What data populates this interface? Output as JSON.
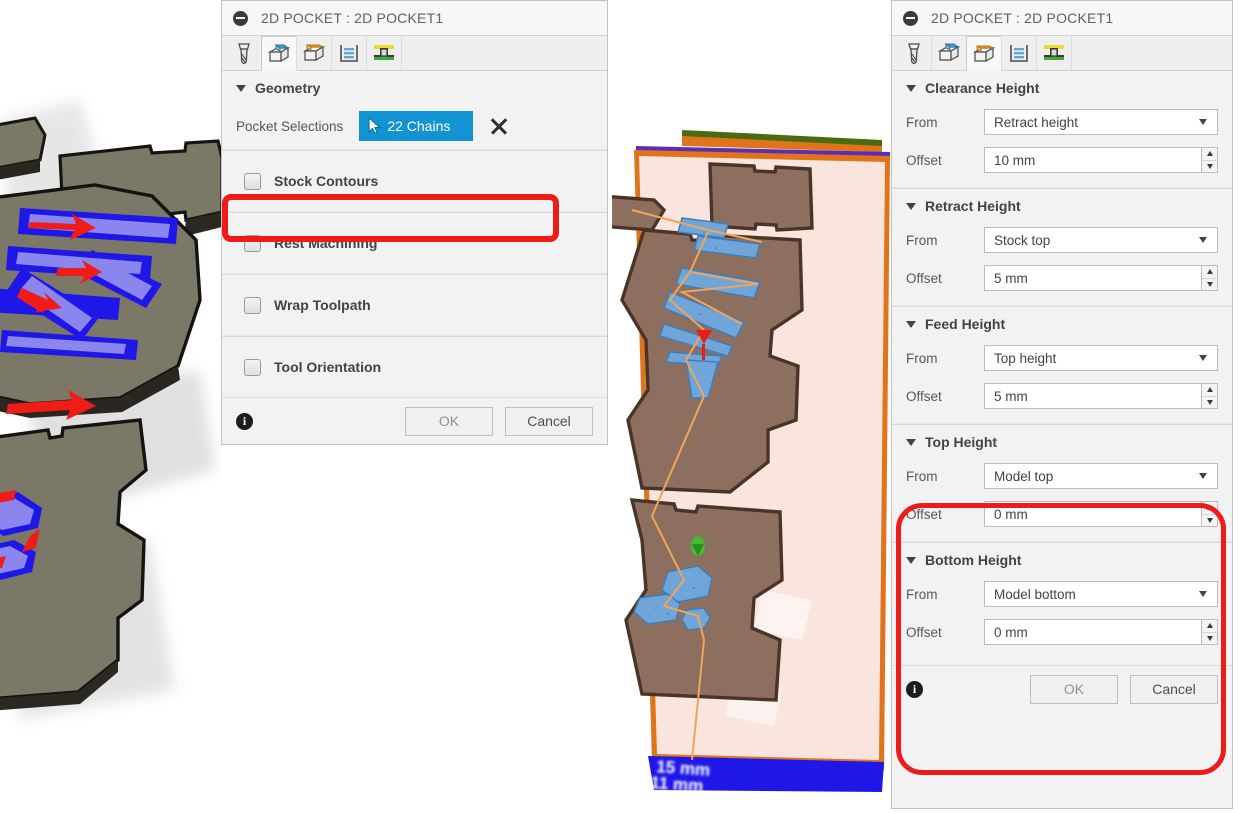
{
  "left_dialog": {
    "title": "2D POCKET : 2D POCKET1",
    "collapse_icon": "collapse-minus-icon",
    "tabs": [
      {
        "name": "tool-tab",
        "icon": "endmill-tool-icon",
        "active": false
      },
      {
        "name": "geometry-tab",
        "icon": "geometry-cube-icon",
        "active": true
      },
      {
        "name": "heights-tab",
        "icon": "heights-cube-icon",
        "active": false
      },
      {
        "name": "passes-tab",
        "icon": "passes-layers-icon",
        "active": false
      },
      {
        "name": "linking-tab",
        "icon": "linking-ramp-icon",
        "active": false
      }
    ],
    "geometry": {
      "section_title": "Geometry",
      "selection_label": "Pocket Selections",
      "chains_button_label": "22 Chains",
      "chains_button_color": "#1294d4",
      "chains_cursor_icon": "cursor-arrow-icon",
      "clear_icon": "close-x-icon"
    },
    "options": [
      {
        "label": "Stock Contours",
        "checked": false,
        "highlighted": true
      },
      {
        "label": "Rest Machining",
        "checked": false,
        "highlighted": false
      },
      {
        "label": "Wrap Toolpath",
        "checked": false,
        "highlighted": false
      },
      {
        "label": "Tool Orientation",
        "checked": false,
        "highlighted": false
      }
    ],
    "footer": {
      "info_icon": "info-icon",
      "info_glyph": "i",
      "ok_label": "OK",
      "cancel_label": "Cancel",
      "ok_disabled": true
    }
  },
  "right_dialog": {
    "title": "2D POCKET : 2D POCKET1",
    "collapse_icon": "collapse-minus-icon",
    "tabs": [
      {
        "name": "tool-tab",
        "icon": "endmill-tool-icon",
        "active": false
      },
      {
        "name": "geometry-tab",
        "icon": "geometry-cube-icon",
        "active": false
      },
      {
        "name": "heights-tab",
        "icon": "heights-cube-icon",
        "active": true
      },
      {
        "name": "passes-tab",
        "icon": "passes-layers-icon",
        "active": false
      },
      {
        "name": "linking-tab",
        "icon": "linking-ramp-icon",
        "active": false
      }
    ],
    "from_label": "From",
    "offset_label": "Offset",
    "sections": [
      {
        "title": "Clearance Height",
        "from_value": "Retract height",
        "offset_value": "10 mm",
        "highlighted": false
      },
      {
        "title": "Retract Height",
        "from_value": "Stock top",
        "offset_value": "5 mm",
        "highlighted": false
      },
      {
        "title": "Feed Height",
        "from_value": "Top height",
        "offset_value": "5 mm",
        "highlighted": false
      },
      {
        "title": "Top Height",
        "from_value": "Model top",
        "offset_value": "0 mm",
        "highlighted": true
      },
      {
        "title": "Bottom Height",
        "from_value": "Model bottom",
        "offset_value": "0 mm",
        "highlighted": true
      }
    ],
    "footer": {
      "info_icon": "info-icon",
      "info_glyph": "i",
      "ok_label": "OK",
      "cancel_label": "Cancel",
      "ok_disabled": true
    }
  },
  "viewports": {
    "left": {
      "name": "cam-toolpath-viewport",
      "description": "3D CAM model of grey sheet-metal parts with blue pocket toolpaths and red rapid-move arrows",
      "part_color": "#7c7868",
      "toolpath_color": "#1f17e8",
      "rapid_color": "#ef1c18"
    },
    "middle": {
      "name": "stock-simulation-viewport",
      "description": "Tilted stock plate simulation with pink stock, brown parts, light-blue pocket toolpaths and orange rapid links",
      "stock_color": "#fae4de",
      "part_color": "#8d6f5f",
      "toolpath_color": "#6fa5d8",
      "rapid_color": "#f0a55c",
      "dimension_labels": [
        "15 mm",
        "11 mm"
      ]
    }
  },
  "annotations": {
    "highlight_color": "#ee1b19",
    "shapes": [
      {
        "name": "stock-contours-highlight",
        "target": "Stock Contours"
      },
      {
        "name": "top-bottom-height-highlight",
        "target": "Top Height / Bottom Height"
      }
    ]
  }
}
